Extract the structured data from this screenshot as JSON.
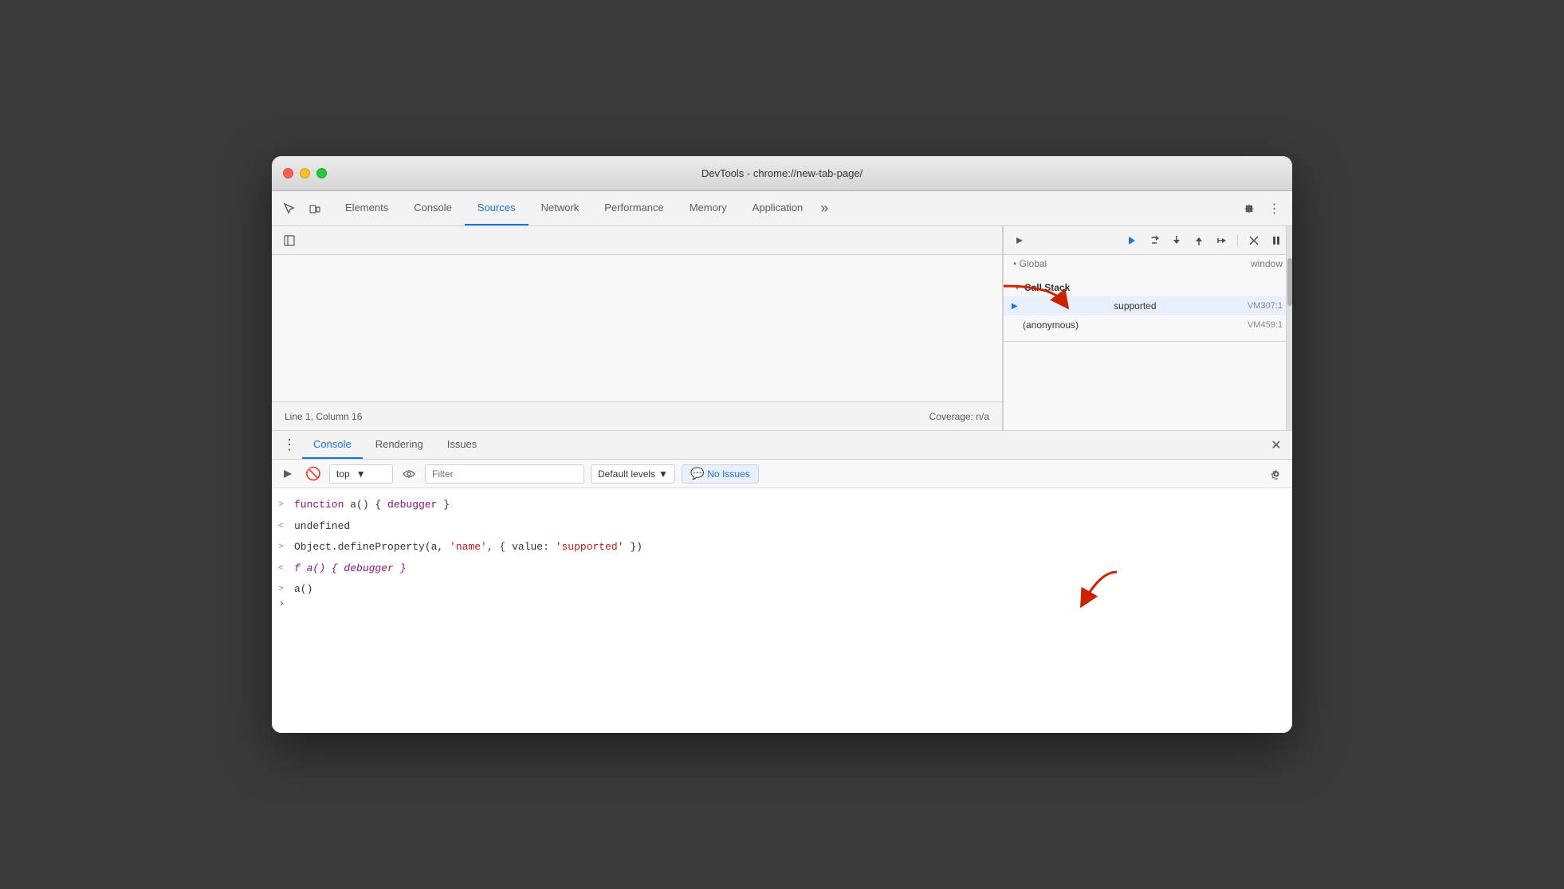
{
  "window": {
    "title": "DevTools - chrome://new-tab-page/"
  },
  "toolbar": {
    "tabs": [
      {
        "label": "Elements",
        "active": false
      },
      {
        "label": "Console",
        "active": false
      },
      {
        "label": "Sources",
        "active": true
      },
      {
        "label": "Network",
        "active": false
      },
      {
        "label": "Performance",
        "active": false
      },
      {
        "label": "Memory",
        "active": false
      },
      {
        "label": "Application",
        "active": false
      }
    ]
  },
  "statusbar": {
    "position": "Line 1, Column 16",
    "coverage": "Coverage: n/a"
  },
  "debugger": {
    "callstack_header": "Call Stack",
    "items": [
      {
        "name": "supported",
        "loc": "VM307:1",
        "active": true
      },
      {
        "name": "(anonymous)",
        "loc": "VM459:1",
        "active": false
      }
    ],
    "truncated": "Global  window"
  },
  "console": {
    "tabs": [
      {
        "label": "Console",
        "active": true
      },
      {
        "label": "Rendering",
        "active": false
      },
      {
        "label": "Issues",
        "active": false
      }
    ],
    "context": "top",
    "filter_placeholder": "Filter",
    "levels_label": "Default levels",
    "no_issues_label": "No Issues",
    "rows": [
      {
        "arrow": ">",
        "type": "input",
        "parts": [
          {
            "text": "function",
            "class": "code-purple"
          },
          {
            "text": " a() { ",
            "class": "code-black"
          },
          {
            "text": "debugger",
            "class": "code-purple"
          },
          {
            "text": " }",
            "class": "code-black"
          }
        ]
      },
      {
        "arrow": "<",
        "type": "output",
        "parts": [
          {
            "text": "undefined",
            "class": "code-black"
          }
        ]
      },
      {
        "arrow": ">",
        "type": "input",
        "parts": [
          {
            "text": "Object.defineProperty(a, ",
            "class": "code-black"
          },
          {
            "text": "'name'",
            "class": "code-red"
          },
          {
            "text": ", { value: ",
            "class": "code-black"
          },
          {
            "text": "'supported'",
            "class": "code-red"
          },
          {
            "text": " })",
            "class": "code-black"
          }
        ]
      },
      {
        "arrow": "<",
        "type": "output",
        "italic": true,
        "parts": [
          {
            "text": "f a() { debugger }",
            "class": "code-italic"
          }
        ]
      },
      {
        "arrow": ">",
        "type": "input",
        "parts": [
          {
            "text": "a()",
            "class": "code-black"
          }
        ]
      }
    ]
  }
}
